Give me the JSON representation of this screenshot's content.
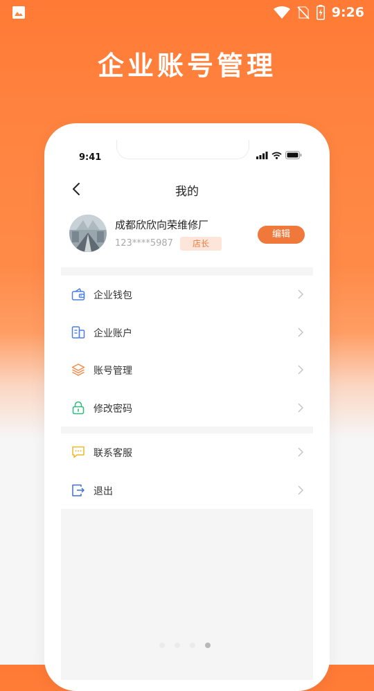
{
  "status_bar": {
    "time": "9:26"
  },
  "page_title": "企业账号管理",
  "phone_mockup": {
    "time": "9:41",
    "nav": {
      "title": "我的"
    },
    "profile": {
      "company_name": "成都欣欣向荣维修厂",
      "phone": "123****5987",
      "role": "店长",
      "edit_label": "编辑"
    },
    "menu_group_1": [
      {
        "label": "企业钱包",
        "icon": "wallet-icon"
      },
      {
        "label": "企业账户",
        "icon": "account-icon"
      },
      {
        "label": "账号管理",
        "icon": "layers-icon"
      },
      {
        "label": "修改密码",
        "icon": "lock-icon"
      }
    ],
    "menu_group_2": [
      {
        "label": "联系客服",
        "icon": "chat-icon"
      },
      {
        "label": "退出",
        "icon": "logout-icon"
      }
    ]
  },
  "carousel": {
    "count": 4,
    "active_index": 3
  },
  "colors": {
    "accent": "#f0783a",
    "header_gradient_top": "#ff7a35",
    "background": "#f6f6f7"
  }
}
